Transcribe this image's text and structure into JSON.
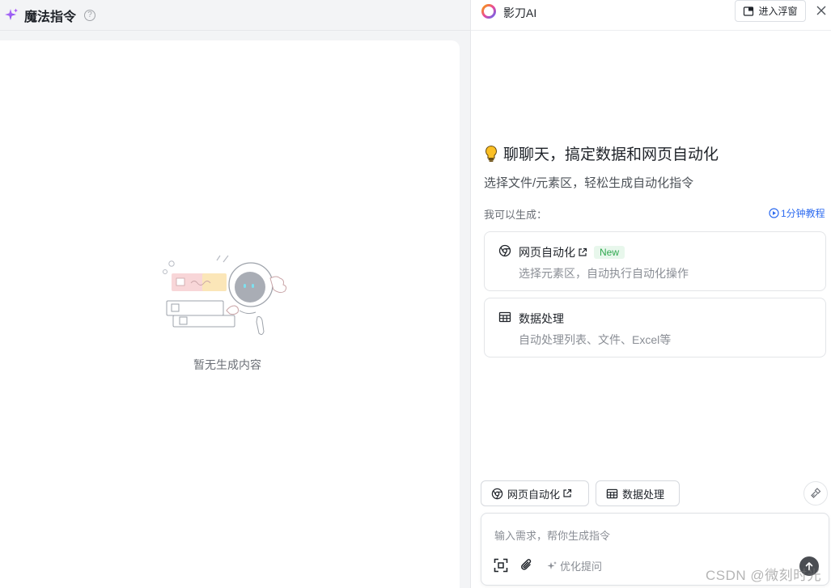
{
  "left_panel": {
    "title": "魔法指令",
    "help_icon": "question-circle-icon",
    "empty_text": "暂无生成内容"
  },
  "right_panel": {
    "app_title": "影刀AI",
    "float_button": "进入浮窗",
    "close_icon": "close-icon",
    "hero_title": "聊聊天，搞定数据和网页自动化",
    "hero_subtitle": "选择文件/元素区，轻松生成自动化指令",
    "generate_label": "我可以生成：",
    "tutorial_link": "1分钟教程",
    "options": [
      {
        "title": "网页自动化",
        "badge": "New",
        "desc": "选择元素区，自动执行自动化操作",
        "icon": "browser-icon"
      },
      {
        "title": "数据处理",
        "desc": "自动处理列表、文件、Excel等",
        "icon": "table-icon"
      }
    ],
    "chips": [
      {
        "label": "网页自动化",
        "icon": "browser-icon"
      },
      {
        "label": "数据处理",
        "icon": "table-icon"
      }
    ],
    "input": {
      "placeholder": "输入需求，帮你生成指令",
      "optimize_label": "优化提问"
    }
  },
  "watermark": "CSDN @微刻时光",
  "colors": {
    "accent": "#2d6bf0",
    "badge_bg": "#e8f7ec",
    "badge_text": "#2fa84f",
    "sparkle": "#a855f7"
  }
}
